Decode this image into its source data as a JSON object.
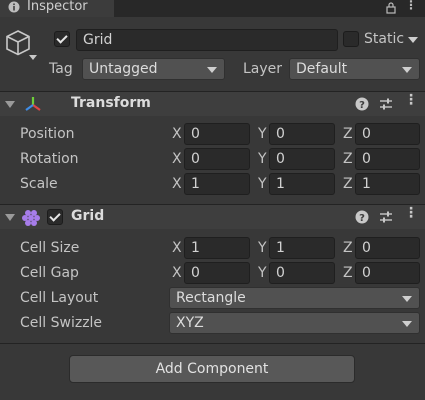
{
  "tab": {
    "title": "Inspector",
    "icon": "info-icon"
  },
  "object": {
    "name": "Grid",
    "active": true,
    "static_label": "Static",
    "static_checked": false,
    "tag_label": "Tag",
    "tag_value": "Untagged",
    "layer_label": "Layer",
    "layer_value": "Default"
  },
  "transform": {
    "title": "Transform",
    "icon": "transform-axes-icon",
    "rows": [
      {
        "label": "Position",
        "x": "0",
        "y": "0",
        "z": "0"
      },
      {
        "label": "Rotation",
        "x": "0",
        "y": "0",
        "z": "0"
      },
      {
        "label": "Scale",
        "x": "1",
        "y": "1",
        "z": "1"
      }
    ]
  },
  "grid": {
    "title": "Grid",
    "icon": "grid-component-icon",
    "enabled": true,
    "cell_size": {
      "label": "Cell Size",
      "x": "1",
      "y": "1",
      "z": "0"
    },
    "cell_gap": {
      "label": "Cell Gap",
      "x": "0",
      "y": "0",
      "z": "0"
    },
    "cell_layout": {
      "label": "Cell Layout",
      "value": "Rectangle"
    },
    "cell_swizzle": {
      "label": "Cell Swizzle",
      "value": "XYZ"
    }
  },
  "axes": {
    "x": "X",
    "y": "Y",
    "z": "Z"
  },
  "add_component_label": "Add Component",
  "colors": {
    "background": "#383838",
    "field": "#2a2a2a",
    "header": "#3e3e3e",
    "transform_icon_red": "#e04545",
    "transform_icon_green": "#6fcf3a",
    "transform_icon_blue": "#3f8de6",
    "grid_icon_purple": "#a77dea"
  }
}
